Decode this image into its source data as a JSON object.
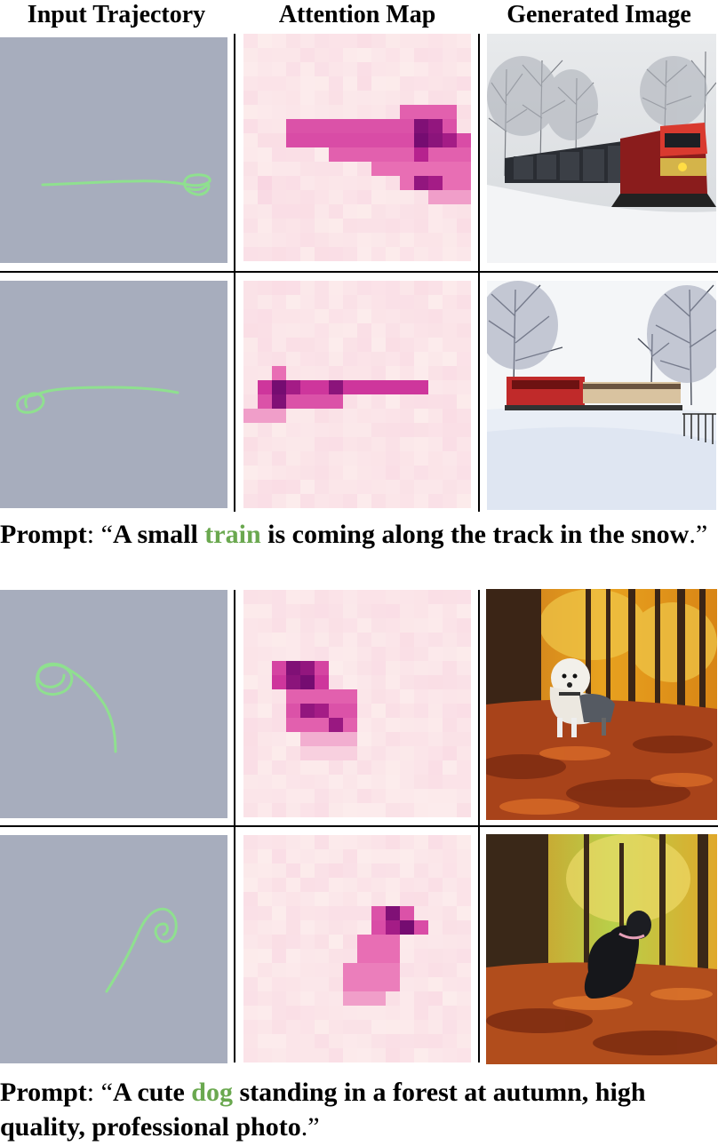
{
  "headers": {
    "col1": "Input Trajectory",
    "col2": "Attention Map",
    "col3": "Generated Image"
  },
  "colors": {
    "trajectory_bg": "#a7adbd",
    "trajectory_stroke": "#8fe08f",
    "keyword": "#6aa84f",
    "attention_bg": "#fcecec"
  },
  "rows": [
    {
      "trajectory": "horizontal-left-to-right-with-loop-end",
      "image": "red train in snowy forest"
    },
    {
      "trajectory": "horizontal-right-to-left-with-loop-start",
      "image": "red train crossing snowy field"
    },
    {
      "trajectory": "loop-top-left-curving-down",
      "image": "white dog in autumn forest"
    },
    {
      "trajectory": "curve-up-to-loop-top-right",
      "image": "black dog sitting in autumn forest"
    }
  ],
  "prompts": [
    {
      "label": "Prompt",
      "colon": ": ",
      "open_quote": "“",
      "before": "A small ",
      "keyword": "train",
      "after": " is coming along the track in the snow",
      "close": ".”"
    },
    {
      "label": "Prompt",
      "colon": ": ",
      "open_quote": "“",
      "before": "A cute ",
      "keyword": "dog",
      "after": " standing in a forest at autumn, high quality, professional photo",
      "close": ".”"
    }
  ]
}
